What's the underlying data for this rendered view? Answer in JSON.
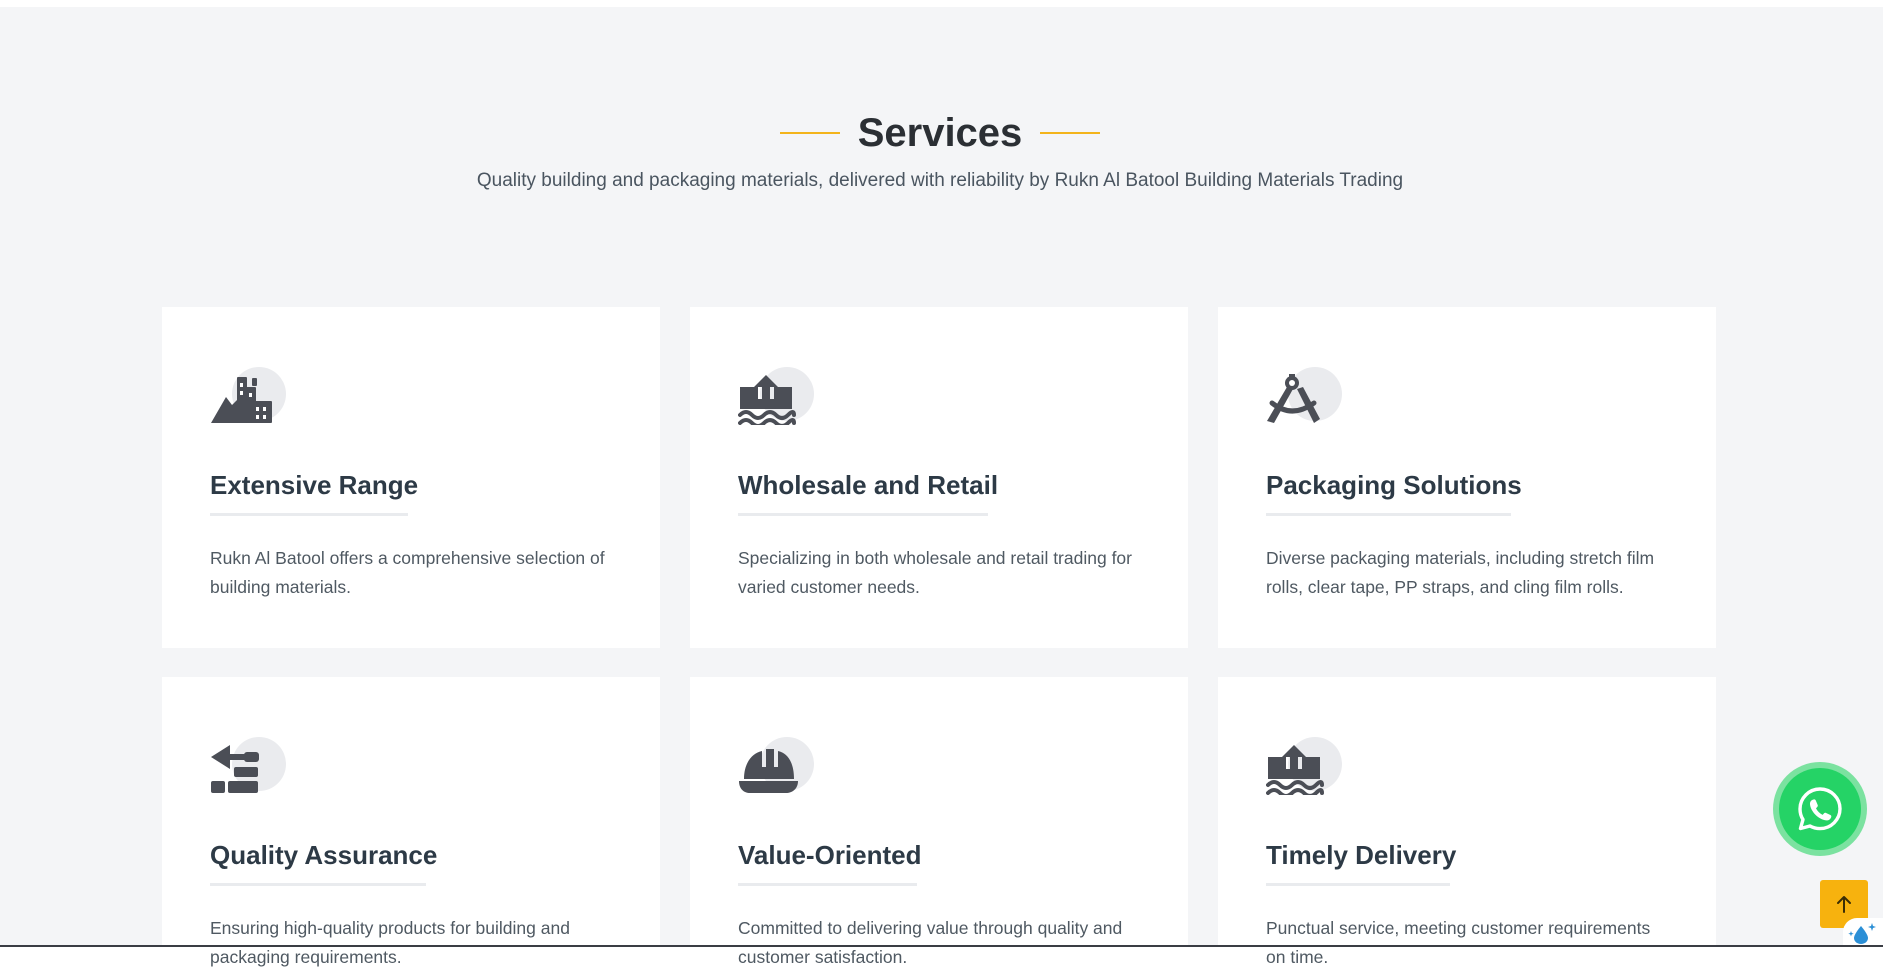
{
  "section": {
    "title": "Services",
    "subtitle": "Quality building and packaging materials, delivered with reliability by Rukn Al Batool Building Materials Trading"
  },
  "theme": {
    "accent": "#f3b41b",
    "icon_color": "#4b4e56",
    "whatsapp_green": "#25d366"
  },
  "services": [
    {
      "icon": "mountain-city-icon",
      "title": "Extensive Range",
      "description": "Rukn Al Batool offers a comprehensive selection of building materials."
    },
    {
      "icon": "house-flood-water-icon",
      "title": "Wholesale and Retail",
      "description": "Specializing in both wholesale and retail trading for varied customer needs."
    },
    {
      "icon": "compass-drafting-icon",
      "title": "Packaging Solutions",
      "description": "Diverse packaging materials, including stretch film rolls, clear tape, PP straps, and cling film rolls."
    },
    {
      "icon": "trowel-bricks-icon",
      "title": "Quality Assurance",
      "description": "Ensuring high-quality products for building and packaging requirements."
    },
    {
      "icon": "helmet-safety-icon",
      "title": "Value-Oriented",
      "description": "Committed to delivering value through quality and customer satisfaction."
    },
    {
      "icon": "house-flood-water-icon",
      "title": "Timely Delivery",
      "description": "Punctual service, meeting customer requirements on time."
    }
  ],
  "floating": {
    "whatsapp_icon": "whatsapp-icon",
    "scroll_top_icon": "arrow-up-icon"
  }
}
